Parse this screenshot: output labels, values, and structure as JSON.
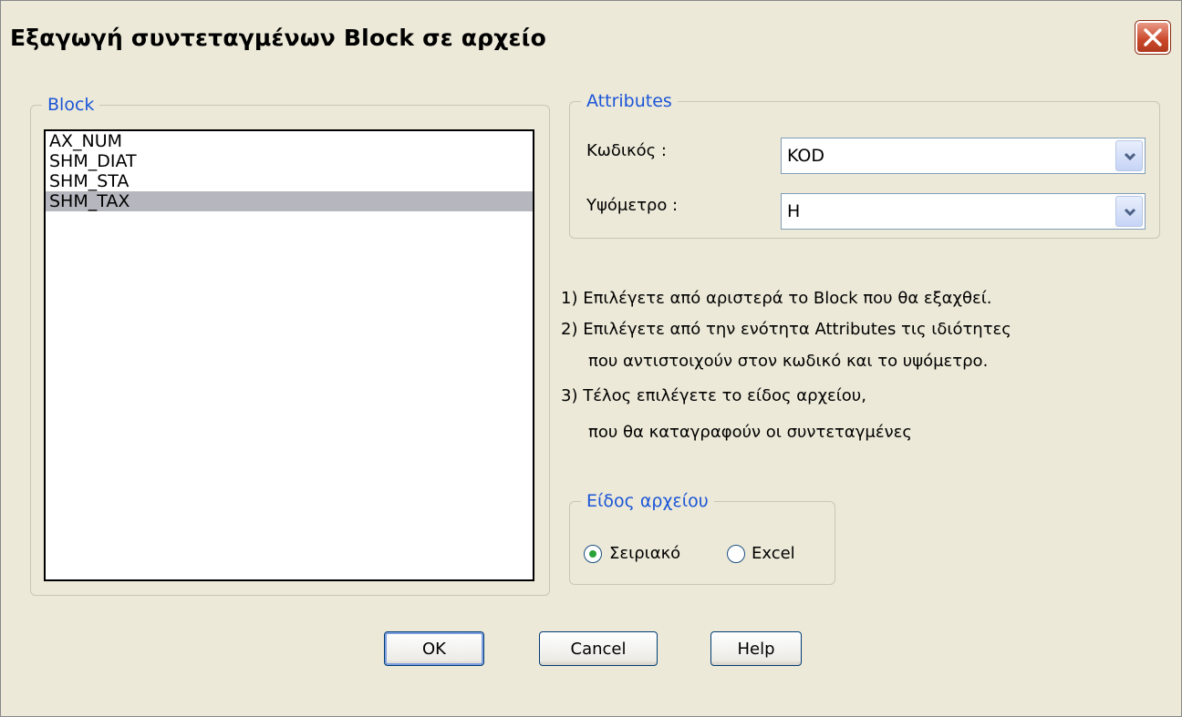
{
  "window": {
    "title": "Εξαγωγή συντεταγμένων Block σε αρχείο",
    "close_icon": "close-icon",
    "close_color": "#c9462a"
  },
  "block_group": {
    "legend": "Block",
    "items": [
      {
        "label": "AX_NUM",
        "selected": false
      },
      {
        "label": "SHM_DIAT",
        "selected": false
      },
      {
        "label": "SHM_STA",
        "selected": false
      },
      {
        "label": "SHM_TAX",
        "selected": true
      }
    ]
  },
  "attributes_group": {
    "legend": "Attributes",
    "code_label": "Κωδικός :",
    "code_value": "KOD",
    "elevation_label": "Υψόμετρο :",
    "elevation_value": "H",
    "dropdown_icon": "chevron-down-icon"
  },
  "instructions": [
    "1) Επιλέγετε από αριστερά το Block που θα εξαχθεί.",
    "2) Επιλέγετε από την ενότητα Attributes τις ιδιότητες",
    "που αντιστοιχούν στον κωδικό και το υψόμετρο.",
    "3) Τέλος επιλέγετε το είδος αρχείου,",
    "που θα καταγραφούν οι συντεταγμένες"
  ],
  "file_type_group": {
    "legend": "Είδος αρχείου",
    "options": [
      {
        "label": "Σειριακό",
        "selected": true
      },
      {
        "label": "Excel",
        "selected": false
      }
    ]
  },
  "buttons": {
    "ok": "OK",
    "cancel": "Cancel",
    "help": "Help"
  },
  "colors": {
    "dialog_bg": "#ece9d8",
    "legend_text": "#1b55d8",
    "selection_bg": "#b6b6be",
    "radio_dot": "#2ca23a"
  }
}
